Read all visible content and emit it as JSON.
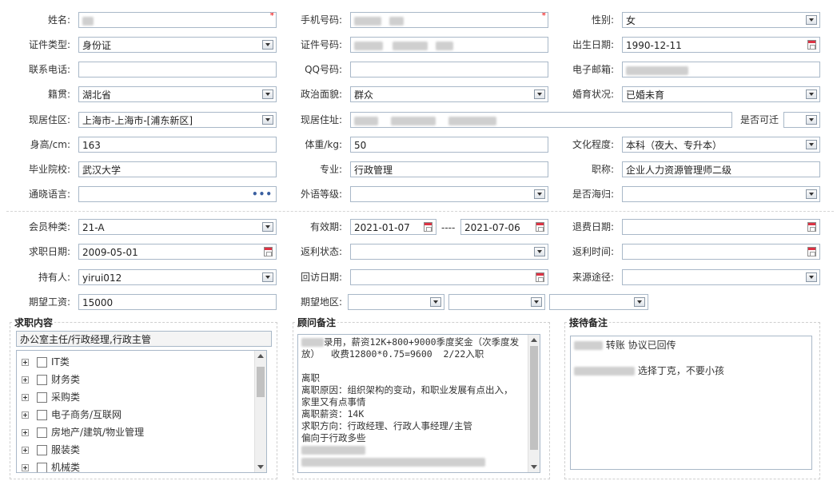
{
  "personal": {
    "name": {
      "label": "姓名:",
      "value": "",
      "required": true
    },
    "mobile": {
      "label": "手机号码:",
      "value": "",
      "required": true
    },
    "gender": {
      "label": "性别:",
      "value": "女"
    },
    "id_type": {
      "label": "证件类型:",
      "value": "身份证"
    },
    "id_number": {
      "label": "证件号码:",
      "value": ""
    },
    "birth_date": {
      "label": "出生日期:",
      "value": "1990-12-11"
    },
    "phone": {
      "label": "联系电话:",
      "value": ""
    },
    "qq": {
      "label": "QQ号码:",
      "value": ""
    },
    "email": {
      "label": "电子邮箱:",
      "value": ""
    },
    "native_place": {
      "label": "籍贯:",
      "value": "湖北省"
    },
    "political_status": {
      "label": "政治面貌:",
      "value": "群众"
    },
    "marital_status": {
      "label": "婚育状况:",
      "value": "已婚未育"
    },
    "current_area": {
      "label": "现居住区:",
      "value": "上海市-上海市-[浦东新区]"
    },
    "current_address": {
      "label": "现居住址:",
      "value": ""
    },
    "relocate": {
      "label": "是否可迁",
      "value": ""
    },
    "height": {
      "label": "身高/cm:",
      "value": "163"
    },
    "weight": {
      "label": "体重/kg:",
      "value": "50"
    },
    "education": {
      "label": "文化程度:",
      "value": "本科（夜大、专升本）"
    },
    "school": {
      "label": "毕业院校:",
      "value": "武汉大学"
    },
    "major": {
      "label": "专业:",
      "value": "行政管理"
    },
    "title": {
      "label": "职称:",
      "value": "企业人力资源管理师二级"
    },
    "languages": {
      "label": "通晓语言:",
      "value": ""
    },
    "foreign_level": {
      "label": "外语等级:",
      "value": ""
    },
    "overseas": {
      "label": "是否海归:",
      "value": ""
    }
  },
  "membership": {
    "member_type": {
      "label": "会员种类:",
      "value": "21-A"
    },
    "valid_period": {
      "label": "有效期:",
      "start": "2021-01-07",
      "separator": "----",
      "end": "2021-07-06"
    },
    "refund_date": {
      "label": "退费日期:",
      "value": ""
    },
    "job_date": {
      "label": "求职日期:",
      "value": "2009-05-01"
    },
    "rebate_status": {
      "label": "返利状态:",
      "value": ""
    },
    "rebate_time": {
      "label": "返利时间:",
      "value": ""
    },
    "holder": {
      "label": "持有人:",
      "value": "yirui012"
    },
    "revisit_date": {
      "label": "回访日期:",
      "value": ""
    },
    "source": {
      "label": "来源途径:",
      "value": ""
    },
    "expected_salary": {
      "label": "期望工资:",
      "value": "15000"
    },
    "expected_region": {
      "label": "期望地区:",
      "values": [
        "",
        "",
        ""
      ]
    }
  },
  "job_content": {
    "legend": "求职内容",
    "selected": "办公室主任/行政经理,行政主管",
    "categories": [
      "IT类",
      "财务类",
      "采购类",
      "电子商务/互联网",
      "房地产/建筑/物业管理",
      "服装类",
      "机械类"
    ]
  },
  "consultant_notes": {
    "legend": "顾问备注",
    "lines": [
      "录用，薪资12K+800+9000季度奖金（次季度发",
      "放）  收费12800*0.75=9600  2/22入职",
      "",
      "离职",
      "离职原因：组织架构的变动，和职业发展有点出入，",
      "家里又有点事情",
      "离职薪资：14K",
      "求职方向：行政经理、行政人事经理/主管",
      "偏向于行政多些"
    ]
  },
  "reception_notes": {
    "legend": "接待备注",
    "line1": "转账 协议已回传",
    "line2": "选择丁克，不要小孩"
  }
}
